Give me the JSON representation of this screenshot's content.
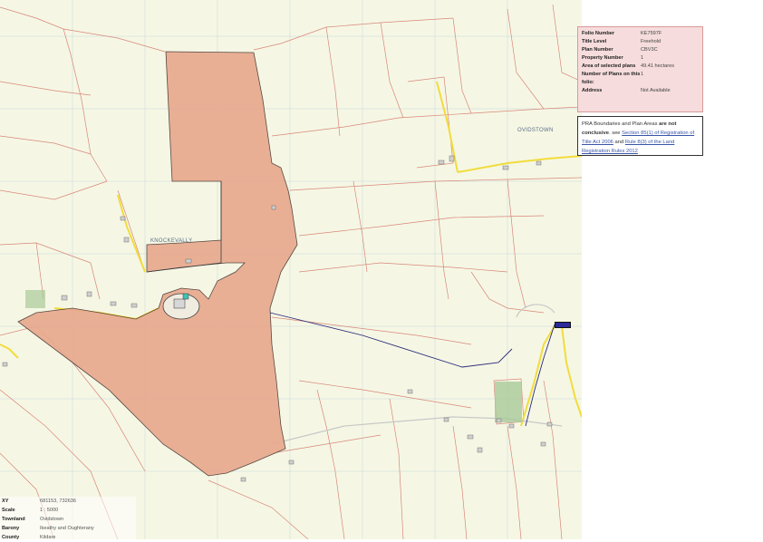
{
  "info": {
    "rows": [
      {
        "key": "Folio Number",
        "value": "KE7597F"
      },
      {
        "key": "Title Level",
        "value": "Freehold"
      },
      {
        "key": "Plan Number",
        "value": "CBV3C"
      },
      {
        "key": "Property Number",
        "value": "1"
      },
      {
        "key": "Area of selected plans",
        "value": "49.41 hectares"
      },
      {
        "key": "Number of Plans on this folio:",
        "value": "1"
      },
      {
        "key": "Address",
        "value": "Not Available"
      }
    ]
  },
  "notice": {
    "part1": "PRA Boundaries and Plan Areas",
    "bold": "are not conclusive",
    "part2": ". see",
    "link1": "Section 85(1) of Registration of Title Act 2006",
    "part3": "and",
    "link2": "Rule 8(3) of the Land Registration Rules 2012"
  },
  "townland_labels": {
    "knockevally": "KNOCKEVALLY",
    "ovidstown": "OVIDSTOWN"
  },
  "legend": {
    "rows": [
      {
        "key": "XY",
        "value": "681153, 732636"
      },
      {
        "key": "Scale",
        "value": "1 : 5000"
      },
      {
        "key": "Townland",
        "value": "Ovidstown"
      },
      {
        "key": "Barony",
        "value": "Ikeathy and Oughterany"
      },
      {
        "key": "County",
        "value": "Kildare"
      }
    ]
  },
  "colors": {
    "map_background": "#f5f7e4",
    "parcel_fill": "#e7a98f",
    "field_boundary": "#d9867a",
    "road": "#f2dc3c",
    "grid": "#7fa6b8"
  }
}
